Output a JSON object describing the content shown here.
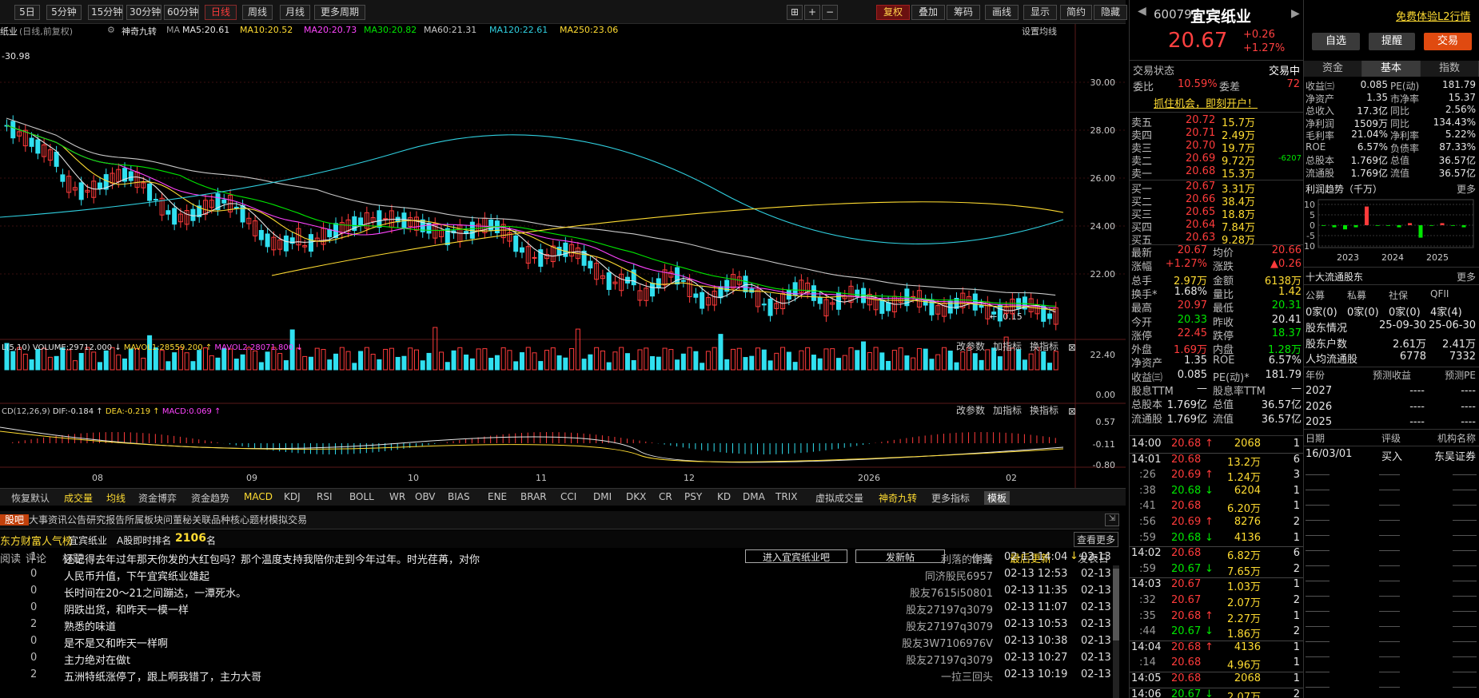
{
  "toolbar": {
    "items": [
      "5日",
      "5分钟",
      "15分钟",
      "30分钟",
      "60分钟",
      "日线",
      "周线",
      "月线",
      "更多周期"
    ],
    "right": [
      "复权",
      "叠加",
      "筹码",
      "画线",
      "显示",
      "简约",
      "隐藏"
    ]
  },
  "stock": {
    "code": "600793",
    "name": "宜宾纸业",
    "price": "20.67",
    "change": "+0.26",
    "pct": "+1.27%",
    "free": "免费体验L2行情",
    "btn_zixuan": "自选",
    "btn_remind": "提醒",
    "btn_trade": "交易"
  },
  "ma_line": {
    "label": "(日线,前复权)",
    "ind": "神奇九转",
    "ma": "MA",
    "ma5": "MA5:20.61",
    "ma10": "MA10:20.52",
    "ma20": "MA20:20.73",
    "ma30": "MA30:20.82",
    "ma60": "MA60:21.31",
    "ma120": "MA120:22.61",
    "ma250": "MA250:23.06",
    "settings": "设置均线"
  },
  "price_axis": [
    "30.00",
    "28.00",
    "26.00",
    "24.00",
    "22.00"
  ],
  "low_label": "20.15",
  "high_label": "30.98",
  "vol_line": {
    "vol": "VOLUME:29712.000",
    "mav1": "MAVOL1:28559.200",
    "mav2": "MAVOL2:28071.800",
    "btns": [
      "改参数",
      "加指标",
      "换指标"
    ]
  },
  "vol_axis": [
    "22.40",
    "0.00"
  ],
  "macd_line": {
    "dif": "DIF:-0.184",
    "dea": "DEA:-0.219",
    "macd": "MACD:0.069"
  },
  "macd_axis": [
    "0.57",
    "-0.11",
    "-0.80"
  ],
  "date_axis": [
    "08",
    "09",
    "10",
    "11",
    "12",
    "2026",
    "02"
  ],
  "ind_tabs": [
    "恢复默认",
    "成交量",
    "均线",
    "资金博弈",
    "资金趋势",
    "MACD",
    "KDJ",
    "RSI",
    "BOLL",
    "WR",
    "OBV",
    "BIAS",
    "ENE",
    "BRAR",
    "CCI",
    "DMI",
    "DKX",
    "CR",
    "PSY",
    "KD",
    "DMA",
    "TRIX",
    "虚拟成交量",
    "神奇九转",
    "更多指标",
    "模板"
  ],
  "news_tabs": [
    "股吧",
    "大事",
    "资讯",
    "公告",
    "研究报告",
    "所属板块",
    "问董秘",
    "关联品种",
    "核心题材",
    "模拟交易"
  ],
  "rank": {
    "title": "东方财富人气榜",
    "name": "宜宾纸业",
    "label": "A股即时排名",
    "value": "2106",
    "unit": "名",
    "more": "查看更多"
  },
  "news_head": {
    "read": "阅读",
    "comment": "评论",
    "title": "标题",
    "enter": "进入宜宾纸业吧",
    "post": "发新帖",
    "author": "作者",
    "updated": "最后更新",
    "posted": "发表日"
  },
  "posts": [
    {
      "c": "1",
      "t": "还记得去年过年那天你发的大红包吗？那个温度支持我陪你走到今年过年。时光荏苒，对你",
      "a": "利落的谢涛",
      "u": "02-13 14:04",
      "d": "02-13"
    },
    {
      "c": "0",
      "t": "人民币升值，下午宜宾纸业雄起",
      "a": "同济股民6957",
      "u": "02-13 12:53",
      "d": "02-13"
    },
    {
      "c": "0",
      "t": "长时间在20～21之间蹦达，一潭死水。",
      "a": "股友7615i50801",
      "u": "02-13 11:35",
      "d": "02-13"
    },
    {
      "c": "0",
      "t": "阴跌出货，和昨天一模一样",
      "a": "股友27197q3079",
      "u": "02-13 11:07",
      "d": "02-13"
    },
    {
      "c": "2",
      "t": "熟悉的味道",
      "a": "股友27197q3079",
      "u": "02-13 10:53",
      "d": "02-13"
    },
    {
      "c": "0",
      "t": "是不是又和昨天一样啊",
      "a": "股友3W7106976V",
      "u": "02-13 10:38",
      "d": "02-13"
    },
    {
      "c": "0",
      "t": "主力绝对在做t",
      "a": "股友27197q3079",
      "u": "02-13 10:27",
      "d": "02-13"
    },
    {
      "c": "2",
      "t": "五洲特纸涨停了，跟上啊我错了，主力大哥",
      "a": "一拉三回头",
      "u": "02-13 10:19",
      "d": "02-13"
    }
  ],
  "quote": {
    "state_label": "交易状态",
    "state": "交易中",
    "wb_label": "委比",
    "wb": "10.59%",
    "wc_label": "委差",
    "wc": "72",
    "promo": "抓住机会，即刻开户！",
    "sells": [
      {
        "l": "卖五",
        "p": "20.72",
        "v": "15.7万"
      },
      {
        "l": "卖四",
        "p": "20.71",
        "v": "2.49万"
      },
      {
        "l": "卖三",
        "p": "20.70",
        "v": "19.7万"
      },
      {
        "l": "卖二",
        "p": "20.69",
        "v": "9.72万",
        "x": "-6207"
      },
      {
        "l": "卖一",
        "p": "20.68",
        "v": "15.3万"
      }
    ],
    "buys": [
      {
        "l": "买一",
        "p": "20.67",
        "v": "3.31万"
      },
      {
        "l": "买二",
        "p": "20.66",
        "v": "38.4万"
      },
      {
        "l": "买三",
        "p": "20.65",
        "v": "18.8万"
      },
      {
        "l": "买四",
        "p": "20.64",
        "v": "7.84万"
      },
      {
        "l": "买五",
        "p": "20.63",
        "v": "9.28万"
      }
    ],
    "stats": [
      [
        "最新",
        "20.67",
        "均价",
        "20.66"
      ],
      [
        "涨幅",
        "+1.27%",
        "涨跌",
        "▲0.26"
      ],
      [
        "总手",
        "2.97万",
        "金额",
        "6138万"
      ],
      [
        "换手*",
        "1.68%",
        "量比",
        "1.42"
      ],
      [
        "最高",
        "20.97",
        "最低",
        "20.31"
      ],
      [
        "今开",
        "20.33",
        "昨收",
        "20.41"
      ],
      [
        "涨停",
        "22.45",
        "跌停",
        "18.37"
      ],
      [
        "外盘",
        "1.69万",
        "内盘",
        "1.28万"
      ],
      [
        "净资产",
        "1.35",
        "ROE",
        "6.57%"
      ],
      [
        "收益㈢",
        "0.085",
        "PE(动)*",
        "181.79"
      ],
      [
        "股息TTM",
        "—",
        "股息率TTM",
        "—"
      ],
      [
        "总股本",
        "1.769亿",
        "总值",
        "36.57亿"
      ],
      [
        "流通股",
        "1.769亿",
        "流值",
        "36.57亿"
      ]
    ]
  },
  "ticks": [
    {
      "t": "14:00",
      "p": "20.68",
      "a": "↑",
      "v": "2068",
      "n": "1"
    },
    {
      "t": "14:01",
      "p": "20.68",
      "a": "",
      "v": "13.2万",
      "n": "6"
    },
    {
      "t": ":26",
      "p": "20.69",
      "a": "↑",
      "v": "1.24万",
      "n": "3"
    },
    {
      "t": ":38",
      "p": "20.68",
      "a": "↓",
      "v": "6204",
      "n": "1"
    },
    {
      "t": ":41",
      "p": "20.68",
      "a": "",
      "v": "6.20万",
      "n": "1"
    },
    {
      "t": ":56",
      "p": "20.69",
      "a": "↑",
      "v": "8276",
      "n": "2"
    },
    {
      "t": ":59",
      "p": "20.68",
      "a": "↓",
      "v": "4136",
      "n": "1"
    },
    {
      "t": "14:02",
      "p": "20.68",
      "a": "",
      "v": "6.82万",
      "n": "6"
    },
    {
      "t": ":59",
      "p": "20.67",
      "a": "↓",
      "v": "7.65万",
      "n": "2"
    },
    {
      "t": "14:03",
      "p": "20.67",
      "a": "",
      "v": "1.03万",
      "n": "1"
    },
    {
      "t": ":32",
      "p": "20.67",
      "a": "",
      "v": "2.07万",
      "n": "2"
    },
    {
      "t": ":35",
      "p": "20.68",
      "a": "↑",
      "v": "2.27万",
      "n": "1"
    },
    {
      "t": ":44",
      "p": "20.67",
      "a": "↓",
      "v": "1.86万",
      "n": "2"
    },
    {
      "t": "14:04",
      "p": "20.68",
      "a": "↑",
      "v": "4136",
      "n": "1"
    },
    {
      "t": ":14",
      "p": "20.68",
      "a": "",
      "v": "4.96万",
      "n": "1"
    },
    {
      "t": "14:05",
      "p": "20.68",
      "a": "",
      "v": "2068",
      "n": "1"
    },
    {
      "t": "14:06",
      "p": "20.67",
      "a": "↓",
      "v": "2.07万",
      "n": "2"
    }
  ],
  "fund": {
    "tabs": [
      "资金",
      "基本",
      "指数"
    ],
    "rows": [
      [
        "收益㈢",
        "0.085",
        "PE(动)",
        "181.79"
      ],
      [
        "净资产",
        "1.35",
        "市净率",
        "15.37"
      ],
      [
        "总收入",
        "17.3亿",
        "同比",
        "2.56%"
      ],
      [
        "净利润",
        "1509万",
        "同比",
        "134.43%"
      ],
      [
        "毛利率",
        "21.04%",
        "净利率",
        "5.22%"
      ],
      [
        "ROE",
        "6.57%",
        "负债率",
        "87.33%"
      ],
      [
        "总股本",
        "1.769亿",
        "总值",
        "36.57亿"
      ],
      [
        "流通股",
        "1.769亿",
        "流值",
        "36.57亿"
      ]
    ],
    "profit_title": "利润趋势（千万）",
    "more": "更多",
    "profit_axis": [
      "10",
      "5",
      "0",
      "-5",
      "-10"
    ],
    "years": [
      "2023",
      "2024",
      "2025"
    ],
    "profit": [
      0,
      -1,
      -2,
      -1,
      9,
      0,
      0,
      -1,
      1,
      -6,
      0,
      1,
      0,
      -1
    ],
    "holders_title": "十大流通股东",
    "holders_head": [
      "公募",
      "私募",
      "社保",
      "QFII"
    ],
    "holders_vals": [
      "0家(0)",
      "0家(0)",
      "0家(0)",
      "4家(4)"
    ],
    "holder_rows": [
      [
        "股东情况",
        "25-09-30",
        "25-06-30"
      ],
      [
        "股东户数",
        "2.61万",
        "2.41万"
      ],
      [
        "人均流通股",
        "6778",
        "7332"
      ]
    ],
    "fc_head": [
      "年份",
      "预测收益",
      "预测PE"
    ],
    "fc_rows": [
      [
        "2027",
        "----",
        "----"
      ],
      [
        "2026",
        "----",
        "----"
      ],
      [
        "2025",
        "----",
        "----"
      ]
    ],
    "rt_head": [
      "日期",
      "评级",
      "机构名称"
    ],
    "rt_rows": [
      [
        "16/03/01",
        "买入",
        "东吴证券"
      ]
    ]
  }
}
